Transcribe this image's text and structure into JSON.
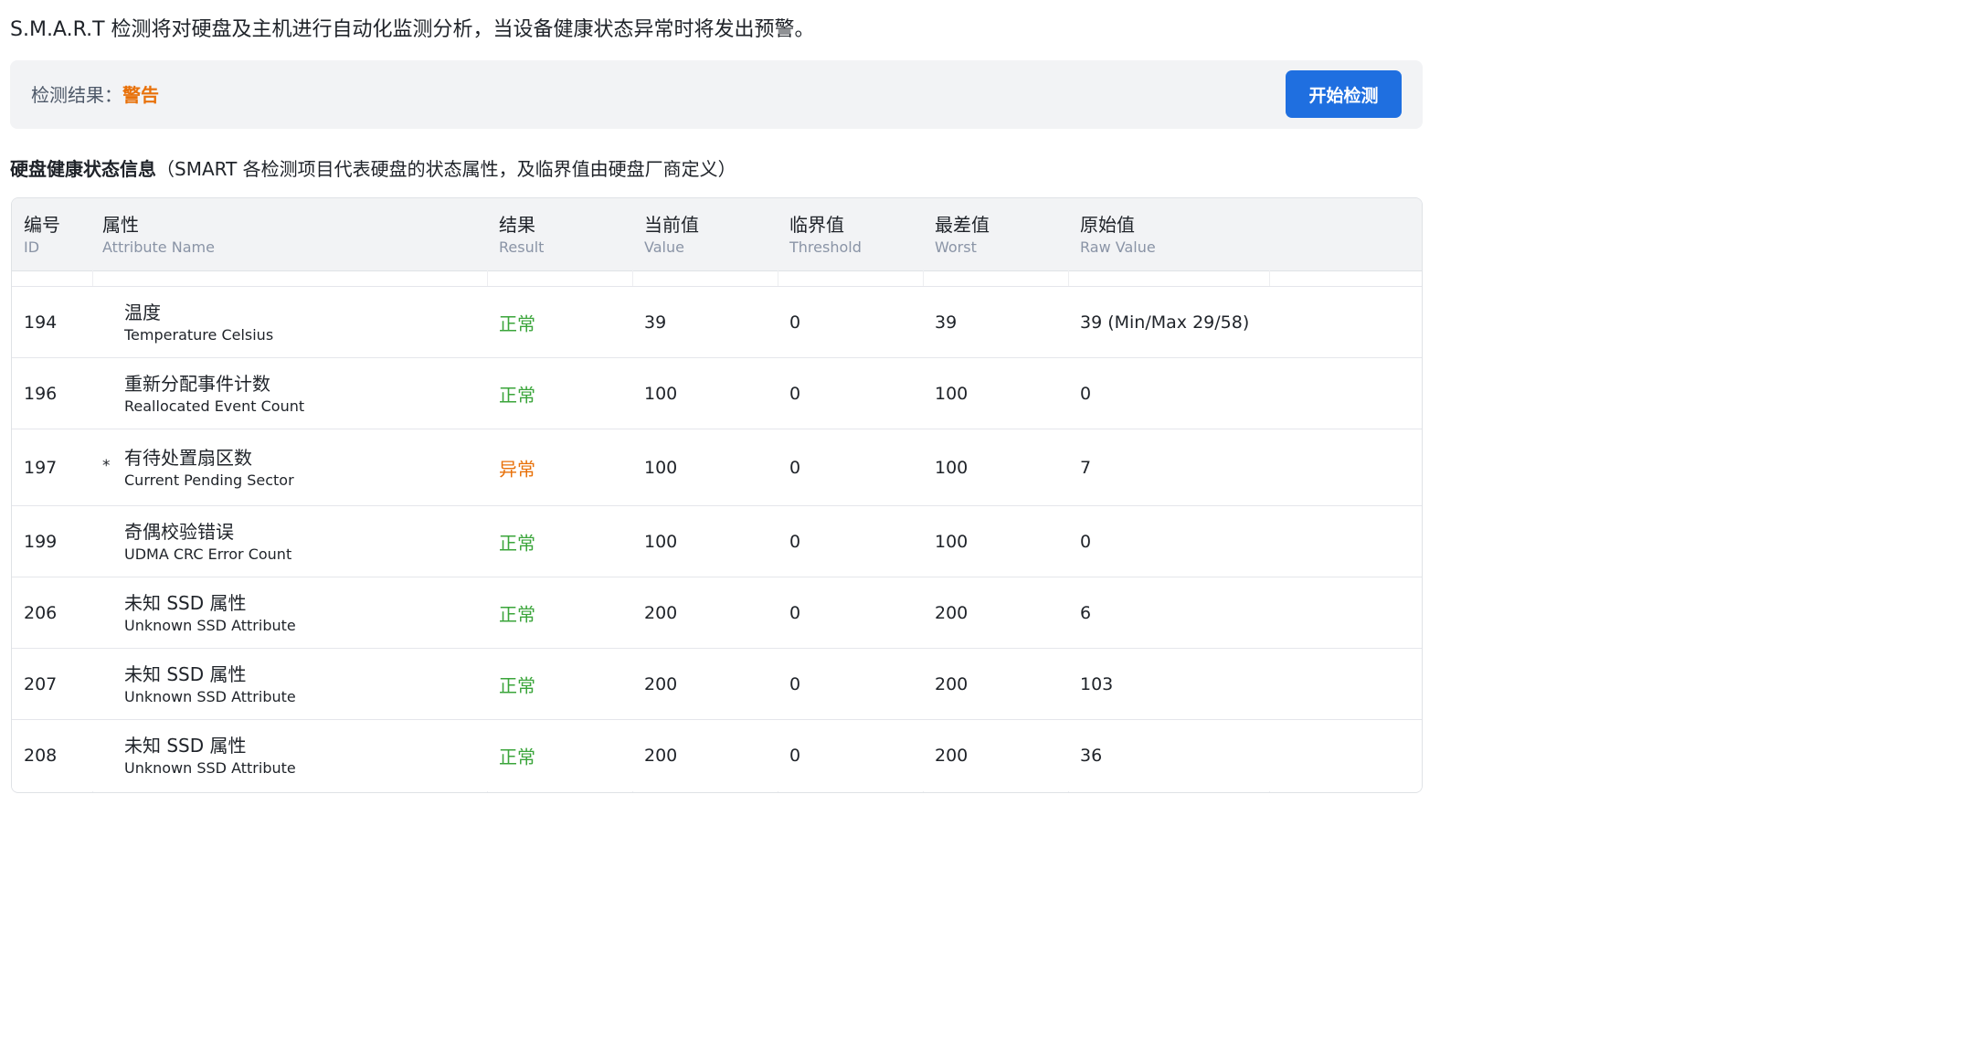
{
  "intro_text": "S.M.A.R.T 检测将对硬盘及主机进行自动化监测分析，当设备健康状态异常时将发出预警。",
  "result_bar": {
    "label": "检测结果：",
    "value": "警告",
    "start_button": "开始检测"
  },
  "section": {
    "title": "硬盘健康状态信息",
    "note": "（SMART 各检测项目代表硬盘的状态属性，及临界值由硬盘厂商定义）"
  },
  "columns": [
    {
      "zh": "编号",
      "en": "ID"
    },
    {
      "zh": "属性",
      "en": "Attribute Name"
    },
    {
      "zh": "结果",
      "en": "Result"
    },
    {
      "zh": "当前值",
      "en": "Value"
    },
    {
      "zh": "临界值",
      "en": "Threshold"
    },
    {
      "zh": "最差值",
      "en": "Worst"
    },
    {
      "zh": "原始值",
      "en": "Raw Value"
    }
  ],
  "rows": [
    {
      "id": "194",
      "marker": "",
      "name_zh": "温度",
      "name_en": "Temperature Celsius",
      "result": "正常",
      "status": "ok",
      "value": "39",
      "threshold": "0",
      "worst": "39",
      "raw": "39 (Min/Max 29/58)"
    },
    {
      "id": "196",
      "marker": "",
      "name_zh": "重新分配事件计数",
      "name_en": "Reallocated Event Count",
      "result": "正常",
      "status": "ok",
      "value": "100",
      "threshold": "0",
      "worst": "100",
      "raw": "0"
    },
    {
      "id": "197",
      "marker": "*",
      "name_zh": "有待处置扇区数",
      "name_en": "Current Pending Sector",
      "result": "异常",
      "status": "bad",
      "value": "100",
      "threshold": "0",
      "worst": "100",
      "raw": "7"
    },
    {
      "id": "199",
      "marker": "",
      "name_zh": "奇偶校验错误",
      "name_en": "UDMA CRC Error Count",
      "result": "正常",
      "status": "ok",
      "value": "100",
      "threshold": "0",
      "worst": "100",
      "raw": "0"
    },
    {
      "id": "206",
      "marker": "",
      "name_zh": "未知 SSD 属性",
      "name_en": "Unknown SSD Attribute",
      "result": "正常",
      "status": "ok",
      "value": "200",
      "threshold": "0",
      "worst": "200",
      "raw": "6"
    },
    {
      "id": "207",
      "marker": "",
      "name_zh": "未知 SSD 属性",
      "name_en": "Unknown SSD Attribute",
      "result": "正常",
      "status": "ok",
      "value": "200",
      "threshold": "0",
      "worst": "200",
      "raw": "103"
    },
    {
      "id": "208",
      "marker": "",
      "name_zh": "未知 SSD 属性",
      "name_en": "Unknown SSD Attribute",
      "result": "正常",
      "status": "ok",
      "value": "200",
      "threshold": "0",
      "worst": "200",
      "raw": "36"
    }
  ],
  "colors": {
    "accent": "#1f6fe0",
    "warning": "#e8710a",
    "ok": "#3ba53b",
    "header_bg": "#f2f3f5"
  }
}
